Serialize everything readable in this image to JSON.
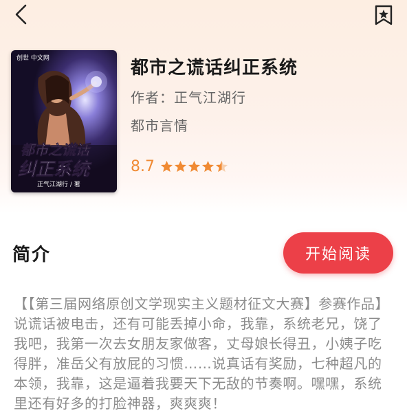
{
  "nav": {
    "back_icon": "chevron-left-icon",
    "bookmark_icon": "bookmark-star-icon"
  },
  "book": {
    "cover": {
      "publisher_logo": "创世 中文网",
      "cover_title_line1": "都市之谎话",
      "cover_title_line2": "纠正系统",
      "cover_author": "正气江湖行 / 著"
    },
    "title": "都市之谎话纠正系统",
    "author": "作者：正气江湖行",
    "category": "都市言情",
    "rating": "8.7",
    "stars": 4.5
  },
  "intro": {
    "heading": "简介",
    "start_reading_label": "开始阅读",
    "text": "【【第三届网络原创文学现实主义题材征文大赛】参赛作品】说谎话被电击，还有可能丢掉小命，我靠，系统老兄，饶了我吧，我第一次去女朋友家做客，丈母娘长得丑，小姨子吃得胖，准岳父有放屁的习惯……说真话有奖励，七种超凡的本领，我靠，这是逼着我要天下无敌的节奏啊。嘿嘿，系统里还有好多的打脸神器，爽爽爽！"
  },
  "colors": {
    "accent_red": "#ec4048",
    "rating_orange": "#f08a33"
  }
}
